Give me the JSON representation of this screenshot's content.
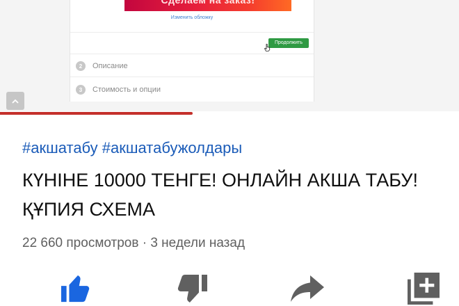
{
  "player": {
    "cover_text": "Сделаем на заказ!",
    "change_cover_link": "Изменить обложку",
    "continue_button": "Продолжить",
    "steps": [
      {
        "number": "2",
        "label": "Описание"
      },
      {
        "number": "3",
        "label": "Стоимость и опции"
      }
    ],
    "progress": 0.42,
    "colors": {
      "progress": "#c4302b",
      "continue_button": "#2f9a43",
      "cover_start": "#c3063f",
      "cover_end": "#ff6a24"
    }
  },
  "video": {
    "hashtags": "#акшатабу #акшатабужолдары",
    "title": "КҮНІНЕ 10000 ТЕНГЕ! ОНЛАЙН АКША ТАБУ! ҚҰПИЯ СХЕМА",
    "meta": "22 660 просмотров · 3 недели назад"
  },
  "actions": [
    {
      "name": "like",
      "icon": "thumbs-up-icon",
      "color": "#1a66e0",
      "active": true
    },
    {
      "name": "dislike",
      "icon": "thumbs-down-icon",
      "color": "#606060",
      "active": false
    },
    {
      "name": "share",
      "icon": "share-icon",
      "color": "#606060",
      "active": false
    },
    {
      "name": "save",
      "icon": "playlist-add-icon",
      "color": "#606060",
      "active": false
    }
  ],
  "colors": {
    "hashtag": "#1a5bb8",
    "title": "#0f0f0f",
    "meta": "#606060"
  }
}
